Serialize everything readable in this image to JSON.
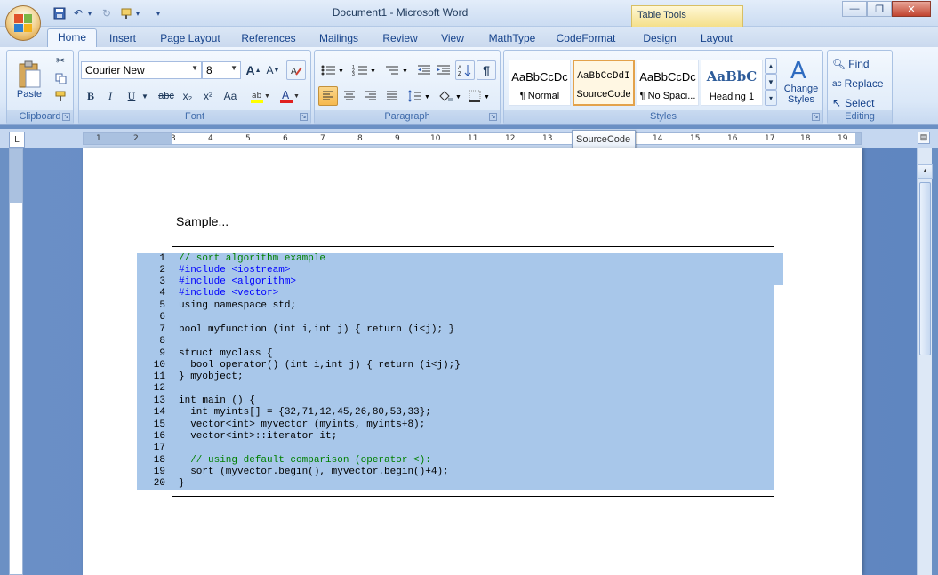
{
  "window": {
    "title": "Document1 - Microsoft Word",
    "contextual_tab_group": "Table Tools",
    "minimize": "—",
    "restore": "❐",
    "close": "✕"
  },
  "tabs": [
    {
      "label": "Home",
      "active": true
    },
    {
      "label": "Insert"
    },
    {
      "label": "Page Layout"
    },
    {
      "label": "References"
    },
    {
      "label": "Mailings"
    },
    {
      "label": "Review"
    },
    {
      "label": "View"
    },
    {
      "label": "MathType"
    },
    {
      "label": "CodeFormat"
    },
    {
      "label": "Design"
    },
    {
      "label": "Layout"
    }
  ],
  "ribbon": {
    "clipboard": {
      "label": "Clipboard",
      "paste": "Paste"
    },
    "font": {
      "label": "Font",
      "font_name": "Courier New",
      "font_size": "8",
      "bold": "B",
      "italic": "I",
      "underline": "U",
      "strikethrough": "abc",
      "subscript": "x₂",
      "superscript": "x²",
      "change_case": "Aa",
      "grow": "A",
      "shrink": "A"
    },
    "paragraph": {
      "label": "Paragraph"
    },
    "styles": {
      "label": "Styles",
      "items": [
        {
          "sample": "AaBbCcDc",
          "name": "¶ Normal"
        },
        {
          "sample": "AaBbCcDdI",
          "name": "SourceCode",
          "selected": true
        },
        {
          "sample": "AaBbCcDc",
          "name": "¶ No Spaci..."
        },
        {
          "sample": "AaBbC",
          "name": "Heading 1"
        }
      ],
      "change_styles": "Change Styles"
    },
    "editing": {
      "label": "Editing",
      "find": "Find",
      "replace": "Replace",
      "select": "Select"
    }
  },
  "ruler": {
    "ticks": [
      "1",
      "2",
      "3",
      "4",
      "5",
      "6",
      "7",
      "8",
      "9",
      "10",
      "11",
      "12",
      "13",
      "14",
      "15",
      "16",
      "17",
      "18",
      "19"
    ]
  },
  "tooltip": "SourceCode",
  "document": {
    "sample_text": "Sample...",
    "code_lines": [
      {
        "n": "1",
        "text": "// sort algorithm example"
      },
      {
        "n": "2",
        "text": "#include <iostream>"
      },
      {
        "n": "3",
        "text": "#include <algorithm>"
      },
      {
        "n": "4",
        "text": "#include <vector>"
      },
      {
        "n": "5",
        "text": "using namespace std;"
      },
      {
        "n": "6",
        "text": ""
      },
      {
        "n": "7",
        "text": "bool myfunction (int i,int j) { return (i<j); }"
      },
      {
        "n": "8",
        "text": ""
      },
      {
        "n": "9",
        "text": "struct myclass {"
      },
      {
        "n": "10",
        "text": "  bool operator() (int i,int j) { return (i<j);}"
      },
      {
        "n": "11",
        "text": "} myobject;"
      },
      {
        "n": "12",
        "text": ""
      },
      {
        "n": "13",
        "text": "int main () {"
      },
      {
        "n": "14",
        "text": "  int myints[] = {32,71,12,45,26,80,53,33};"
      },
      {
        "n": "15",
        "text": "  vector<int> myvector (myints, myints+8);"
      },
      {
        "n": "16",
        "text": "  vector<int>::iterator it;"
      },
      {
        "n": "17",
        "text": ""
      },
      {
        "n": "18",
        "text": "  // using default comparison (operator <):"
      },
      {
        "n": "19",
        "text": "  sort (myvector.begin(), myvector.begin()+4);"
      },
      {
        "n": "20",
        "text": "}"
      }
    ]
  },
  "colors": {
    "selection": "#a8c7ea",
    "comment": "#008000",
    "keyword": "#0000ff",
    "accent_orange": "#e3a24b"
  }
}
